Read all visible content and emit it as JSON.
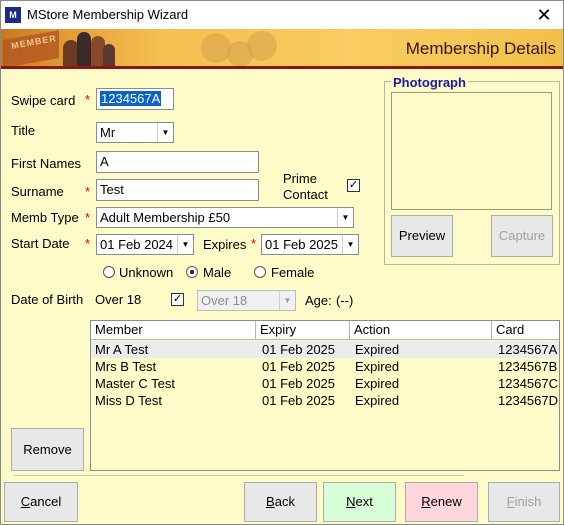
{
  "window": {
    "title": "MStore Membership Wizard",
    "app_icon": "M"
  },
  "banner": {
    "title": "Membership Details",
    "card_text": "MEMBER",
    "accent_color": "#8a1616"
  },
  "form": {
    "swipe_card": {
      "label": "Swipe card",
      "value": "1234567A",
      "required": true
    },
    "title": {
      "label": "Title",
      "value": "Mr"
    },
    "first_names": {
      "label": "First Names",
      "value": "A"
    },
    "surname": {
      "label": "Surname",
      "value": "Test",
      "required": true
    },
    "prime_contact": {
      "label_line1": "Prime",
      "label_line2": "Contact",
      "checked": true
    },
    "memb_type": {
      "label": "Memb Type",
      "value": "Adult Membership £50",
      "required": true
    },
    "start_date": {
      "label": "Start Date",
      "value": "01 Feb 2024",
      "required": true
    },
    "expires": {
      "label": "Expires",
      "value": "01 Feb 2025",
      "required": true
    },
    "gender": {
      "options": [
        "Unknown",
        "Male",
        "Female"
      ],
      "selected": "Male"
    },
    "dob": {
      "label": "Date of Birth",
      "over18_label": "Over 18",
      "over18_checked": true,
      "select_value": "Over 18",
      "age_label": "Age:",
      "age_value": "(--)"
    }
  },
  "photo": {
    "legend": "Photograph",
    "preview_label": "Preview",
    "capture_label": "Capture"
  },
  "members": {
    "columns": [
      "Member",
      "Expiry",
      "Action",
      "Card"
    ],
    "rows": [
      {
        "member": "Mr A Test",
        "expiry": "01 Feb 2025",
        "action": "Expired",
        "card": "1234567A"
      },
      {
        "member": "Mrs B Test",
        "expiry": "01 Feb 2025",
        "action": "Expired",
        "card": "1234567B"
      },
      {
        "member": "Master C Test",
        "expiry": "01 Feb 2025",
        "action": "Expired",
        "card": "1234567C"
      },
      {
        "member": "Miss D Test",
        "expiry": "01 Feb 2025",
        "action": "Expired",
        "card": "1234567D"
      }
    ]
  },
  "remove_label": "Remove",
  "footer": {
    "cancel": {
      "first": "C",
      "rest": "ancel"
    },
    "back": {
      "first": "B",
      "rest": "ack"
    },
    "next": {
      "first": "N",
      "rest": "ext"
    },
    "renew": {
      "first": "R",
      "rest": "enew"
    },
    "finish": {
      "first": "F",
      "rest": "inish"
    }
  }
}
